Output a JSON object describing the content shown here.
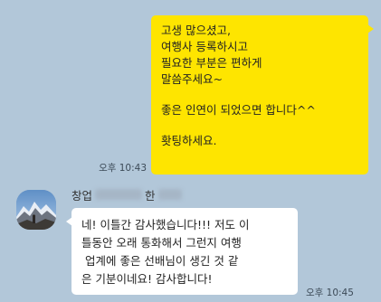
{
  "messages": {
    "outgoing": {
      "lines": [
        "고생 많으셨고,",
        "여행사 등록하시고",
        "필요한 부분은 편하게",
        "말씀주세요~",
        "",
        "좋은 인연이 되었으면 합니다^^",
        "",
        "홧팅하세요."
      ],
      "time": "오후 10:43"
    },
    "incoming": {
      "sender_prefix": "창업",
      "sender_middle": "한",
      "lines": [
        "네! 이틀간 감사했습니다!!! 저도 이",
        "틀동안 오래 통화해서 그런지 여행",
        " 업계에 좋은 선배님이 생긴 것 같",
        "은 기분이네요! 감사합니다!"
      ],
      "time": "오후 10:45"
    }
  }
}
